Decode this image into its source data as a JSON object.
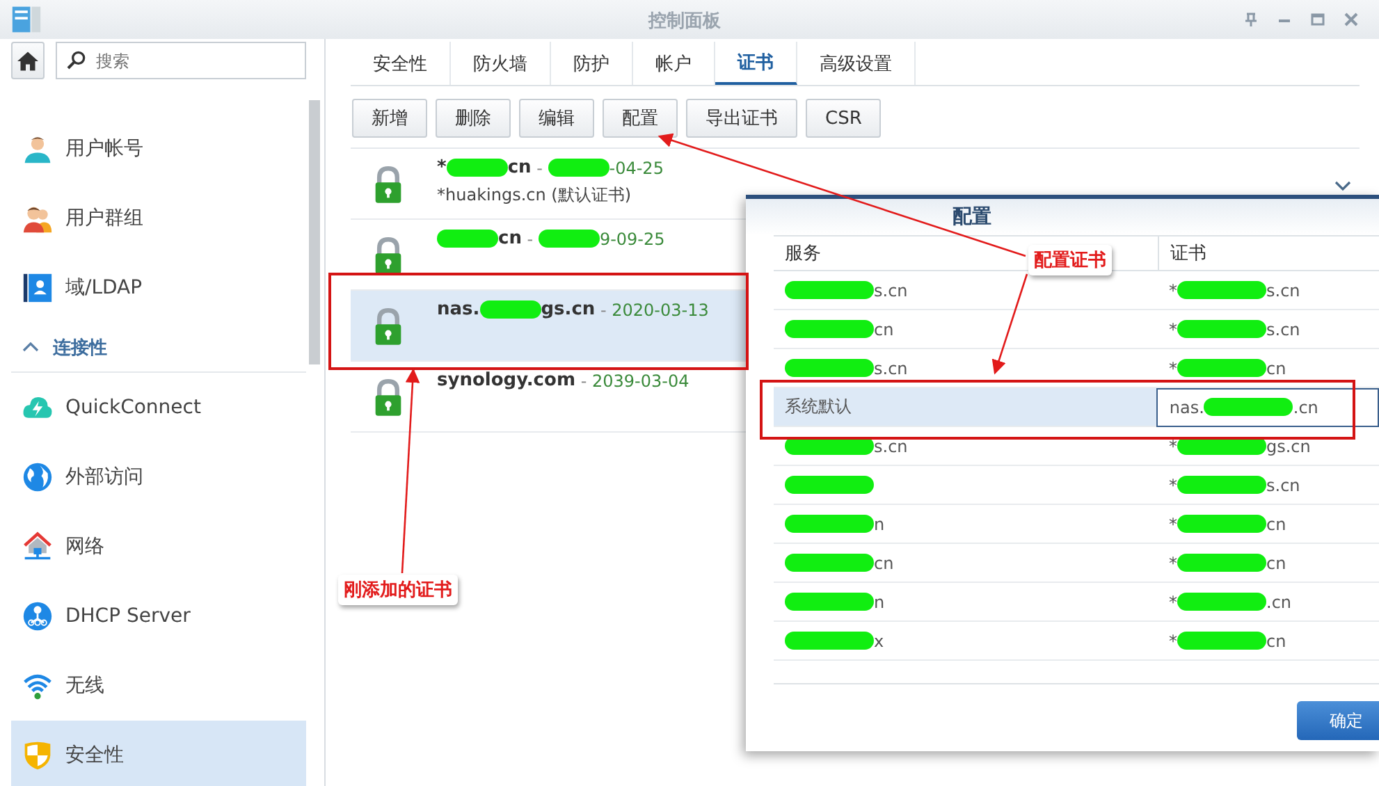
{
  "window": {
    "title": "控制面板"
  },
  "sidebar": {
    "search": {
      "placeholder": "搜索"
    },
    "items": [
      {
        "kind": "item",
        "label": "用户帐号",
        "selected": false
      },
      {
        "kind": "item",
        "label": "用户群组",
        "selected": false
      },
      {
        "kind": "item",
        "label": "域/LDAP",
        "selected": false
      },
      {
        "kind": "section",
        "label": "连接性",
        "expanded": true
      },
      {
        "kind": "item",
        "label": "QuickConnect",
        "selected": false
      },
      {
        "kind": "item",
        "label": "外部访问",
        "selected": false
      },
      {
        "kind": "item",
        "label": "网络",
        "selected": false
      },
      {
        "kind": "item",
        "label": "DHCP Server",
        "selected": false
      },
      {
        "kind": "item",
        "label": "无线",
        "selected": false
      },
      {
        "kind": "item",
        "label": "安全性",
        "selected": true
      }
    ]
  },
  "tabs": [
    {
      "label": "安全性",
      "selected": false
    },
    {
      "label": "防火墙",
      "selected": false
    },
    {
      "label": "防护",
      "selected": false
    },
    {
      "label": "帐户",
      "selected": false
    },
    {
      "label": "证书",
      "selected": true
    },
    {
      "label": "高级设置",
      "selected": false
    }
  ],
  "toolbar": [
    "新增",
    "删除",
    "编辑",
    "配置",
    "导出证书",
    "CSR"
  ],
  "certificates": [
    {
      "selected": false,
      "line": [
        {
          "kind": "name",
          "text": "*"
        },
        {
          "kind": "redacted"
        },
        {
          "kind": "name",
          "text": "cn"
        },
        {
          "kind": "sep",
          "text": " - "
        },
        {
          "kind": "redacted"
        },
        {
          "kind": "date",
          "text": "-04-25"
        }
      ],
      "subtitle": "*huakings.cn (默认证书)"
    },
    {
      "selected": false,
      "line": [
        {
          "kind": "redacted"
        },
        {
          "kind": "name",
          "text": "cn"
        },
        {
          "kind": "sep",
          "text": " - "
        },
        {
          "kind": "redacted"
        },
        {
          "kind": "date",
          "text": "9-09-25"
        }
      ]
    },
    {
      "selected": true,
      "line": [
        {
          "kind": "name",
          "text": "nas."
        },
        {
          "kind": "redacted"
        },
        {
          "kind": "name",
          "text": "gs.cn"
        },
        {
          "kind": "sep",
          "text": " - "
        },
        {
          "kind": "date",
          "text": "2020-03-13"
        }
      ]
    },
    {
      "selected": false,
      "line": [
        {
          "kind": "name",
          "text": "synology.com"
        },
        {
          "kind": "sep",
          "text": " - "
        },
        {
          "kind": "date",
          "text": "2039-03-04"
        }
      ]
    }
  ],
  "dialog": {
    "title": "配置",
    "columns": [
      "服务",
      "证书"
    ],
    "rows": [
      {
        "selected": false,
        "service": [
          {
            "kind": "redacted"
          },
          {
            "kind": "name",
            "text": "s.cn"
          }
        ],
        "certificate": [
          {
            "kind": "name",
            "text": "*"
          },
          {
            "kind": "redacted"
          },
          {
            "kind": "name",
            "text": "s.cn"
          }
        ]
      },
      {
        "selected": false,
        "service": [
          {
            "kind": "redacted"
          },
          {
            "kind": "name",
            "text": "cn"
          }
        ],
        "certificate": [
          {
            "kind": "name",
            "text": "*"
          },
          {
            "kind": "redacted"
          },
          {
            "kind": "name",
            "text": "s.cn"
          }
        ]
      },
      {
        "selected": false,
        "service": [
          {
            "kind": "redacted"
          },
          {
            "kind": "name",
            "text": "s.cn"
          }
        ],
        "certificate": [
          {
            "kind": "name",
            "text": "*"
          },
          {
            "kind": "redacted"
          },
          {
            "kind": "name",
            "text": "cn"
          }
        ]
      },
      {
        "selected": true,
        "service": [
          {
            "kind": "name",
            "text": "系统默认"
          }
        ],
        "certificate": [
          {
            "kind": "name",
            "text": "nas."
          },
          {
            "kind": "redacted"
          },
          {
            "kind": "name",
            "text": ".cn"
          }
        ]
      },
      {
        "selected": false,
        "service": [
          {
            "kind": "redacted"
          },
          {
            "kind": "name",
            "text": "s.cn"
          }
        ],
        "certificate": [
          {
            "kind": "name",
            "text": "*"
          },
          {
            "kind": "redacted"
          },
          {
            "kind": "name",
            "text": "gs.cn"
          }
        ]
      },
      {
        "selected": false,
        "service": [
          {
            "kind": "redacted"
          }
        ],
        "certificate": [
          {
            "kind": "name",
            "text": "*"
          },
          {
            "kind": "redacted"
          },
          {
            "kind": "name",
            "text": "s.cn"
          }
        ]
      },
      {
        "selected": false,
        "service": [
          {
            "kind": "redacted"
          },
          {
            "kind": "name",
            "text": "n"
          }
        ],
        "certificate": [
          {
            "kind": "name",
            "text": "*"
          },
          {
            "kind": "redacted"
          },
          {
            "kind": "name",
            "text": "cn"
          }
        ]
      },
      {
        "selected": false,
        "service": [
          {
            "kind": "redacted"
          },
          {
            "kind": "name",
            "text": "cn"
          }
        ],
        "certificate": [
          {
            "kind": "name",
            "text": "*"
          },
          {
            "kind": "redacted"
          },
          {
            "kind": "name",
            "text": "cn"
          }
        ]
      },
      {
        "selected": false,
        "service": [
          {
            "kind": "redacted"
          },
          {
            "kind": "name",
            "text": "n"
          }
        ],
        "certificate": [
          {
            "kind": "name",
            "text": "*"
          },
          {
            "kind": "redacted"
          },
          {
            "kind": "name",
            "text": ".cn"
          }
        ]
      },
      {
        "selected": false,
        "service": [
          {
            "kind": "redacted"
          },
          {
            "kind": "name",
            "text": "x"
          }
        ],
        "certificate": [
          {
            "kind": "name",
            "text": "*"
          },
          {
            "kind": "redacted"
          },
          {
            "kind": "name",
            "text": "cn"
          }
        ]
      }
    ],
    "ok_button": "确定"
  },
  "annotations": [
    {
      "kind": "callout",
      "text": "配置证书"
    },
    {
      "kind": "callout",
      "text": "刚添加的证书"
    }
  ]
}
